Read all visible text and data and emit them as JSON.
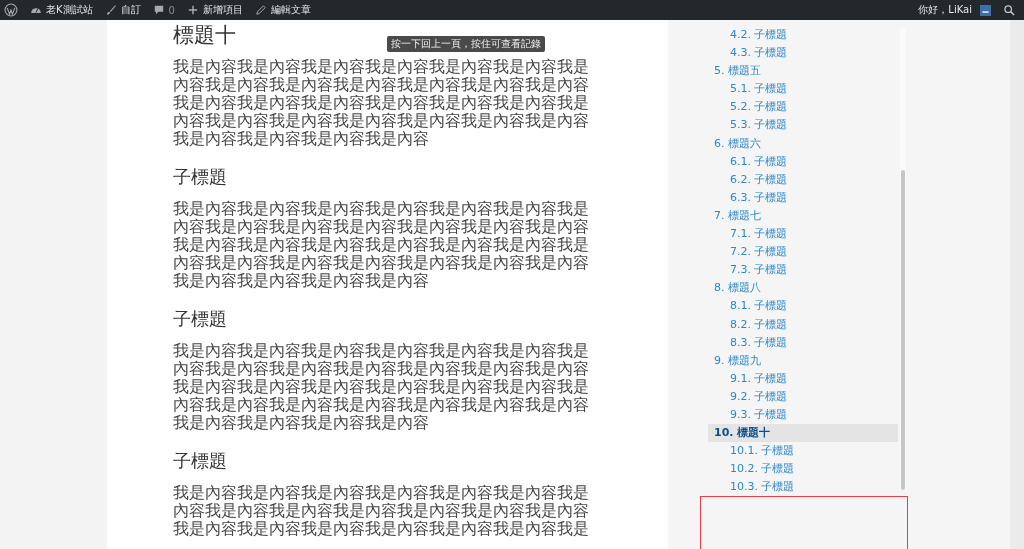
{
  "admin_bar": {
    "site_name": "老K測試站",
    "customize": "自訂",
    "comments_count": "0",
    "new_item": "新增項目",
    "edit_post": "編輯文章",
    "greeting": "你好，LiKai"
  },
  "article": {
    "blocks": [
      {
        "kind": "heading",
        "text": "標題十"
      },
      {
        "kind": "paragraph",
        "text": "我是內容我是內容我是內容我是內容我是內容我是內容我是內容我是內容我是內容我是內容我是內容我是內容我是內容我是內容我是內容我是內容我是內容我是內容我是內容我是內容我是內容我是內容我是內容我是內容我是內容我是內容我是內容我是內容我是內容我是內容"
      },
      {
        "kind": "subheading",
        "text": "子標題"
      },
      {
        "kind": "paragraph",
        "text": "我是內容我是內容我是內容我是內容我是內容我是內容我是內容我是內容我是內容我是內容我是內容我是內容我是內容我是內容我是內容我是內容我是內容我是內容我是內容我是內容我是內容我是內容我是內容我是內容我是內容我是內容我是內容我是內容我是內容我是內容"
      },
      {
        "kind": "subheading",
        "text": "子標題"
      },
      {
        "kind": "paragraph",
        "text": "我是內容我是內容我是內容我是內容我是內容我是內容我是內容我是內容我是內容我是內容我是內容我是內容我是內容我是內容我是內容我是內容我是內容我是內容我是內容我是內容我是內容我是內容我是內容我是內容我是內容我是內容我是內容我是內容我是內容我是內容"
      },
      {
        "kind": "subheading",
        "text": "子標題"
      },
      {
        "kind": "paragraph",
        "text": "我是內容我是內容我是內容我是內容我是內容我是內容我是內容我是內容我是內容我是內容我是內容我是內容我是內容我是內容我是內容我是內容我是內容我是內容我是內容我是"
      }
    ]
  },
  "tooltip": "按一下回上一頁，按住可查看記錄",
  "toc": {
    "items": [
      {
        "children": [
          {
            "label": "4.2. 子標題"
          },
          {
            "label": "4.3. 子標題"
          }
        ]
      },
      {
        "label": "5. 標題五",
        "selected": false,
        "children": [
          {
            "label": "5.1. 子標題"
          },
          {
            "label": "5.2. 子標題"
          },
          {
            "label": "5.3. 子標題"
          }
        ]
      },
      {
        "label": "6. 標題六",
        "selected": false,
        "children": [
          {
            "label": "6.1. 子標題"
          },
          {
            "label": "6.2. 子標題"
          },
          {
            "label": "6.3. 子標題"
          }
        ]
      },
      {
        "label": "7. 標題七",
        "selected": false,
        "children": [
          {
            "label": "7.1. 子標題"
          },
          {
            "label": "7.2. 子標題"
          },
          {
            "label": "7.3. 子標題"
          }
        ]
      },
      {
        "label": "8. 標題八",
        "selected": false,
        "children": [
          {
            "label": "8.1. 子標題"
          },
          {
            "label": "8.2. 子標題"
          },
          {
            "label": "8.3. 子標題"
          }
        ]
      },
      {
        "label": "9. 標題九",
        "selected": false,
        "children": [
          {
            "label": "9.1. 子標題"
          },
          {
            "label": "9.2. 子標題"
          },
          {
            "label": "9.3. 子標題"
          }
        ]
      },
      {
        "label": "10. 標題十",
        "selected": true,
        "children": [
          {
            "label": "10.1. 子標題"
          },
          {
            "label": "10.2. 子標題"
          },
          {
            "label": "10.3. 子標題"
          }
        ]
      }
    ]
  }
}
